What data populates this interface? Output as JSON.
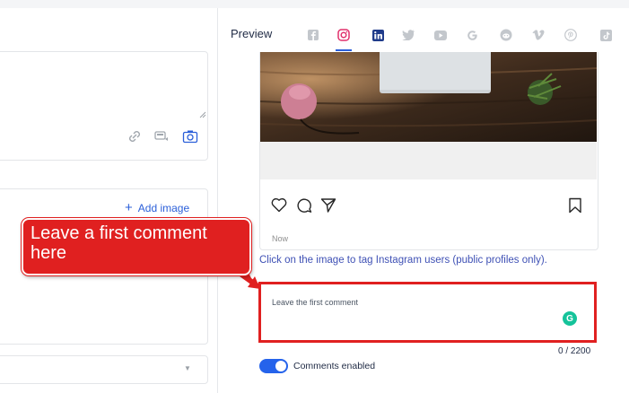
{
  "editor": {
    "tools": [
      "link-icon",
      "media-icon",
      "camera-icon"
    ]
  },
  "image_section": {
    "add_image_label": "Add image"
  },
  "preview": {
    "title": "Preview",
    "networks": [
      "facebook",
      "instagram",
      "linkedin",
      "twitter",
      "youtube",
      "google",
      "reddit",
      "vimeo",
      "pinterest",
      "tiktok"
    ],
    "active_network": "instagram",
    "post_time": "Now",
    "tag_hint": "Click on the image to tag Instagram users (public profiles only).",
    "comment_placeholder": "Leave the first comment",
    "grammarly_letter": "G",
    "char_counter": "0 / 2200",
    "comments_toggle_label": "Comments enabled",
    "comments_enabled": true
  },
  "annotation": {
    "callout_text": "Leave a first comment here",
    "color": "#e02020"
  },
  "colors": {
    "accent": "#2b5fd9",
    "toggle": "#2563eb",
    "grammarly": "#15c39a"
  }
}
